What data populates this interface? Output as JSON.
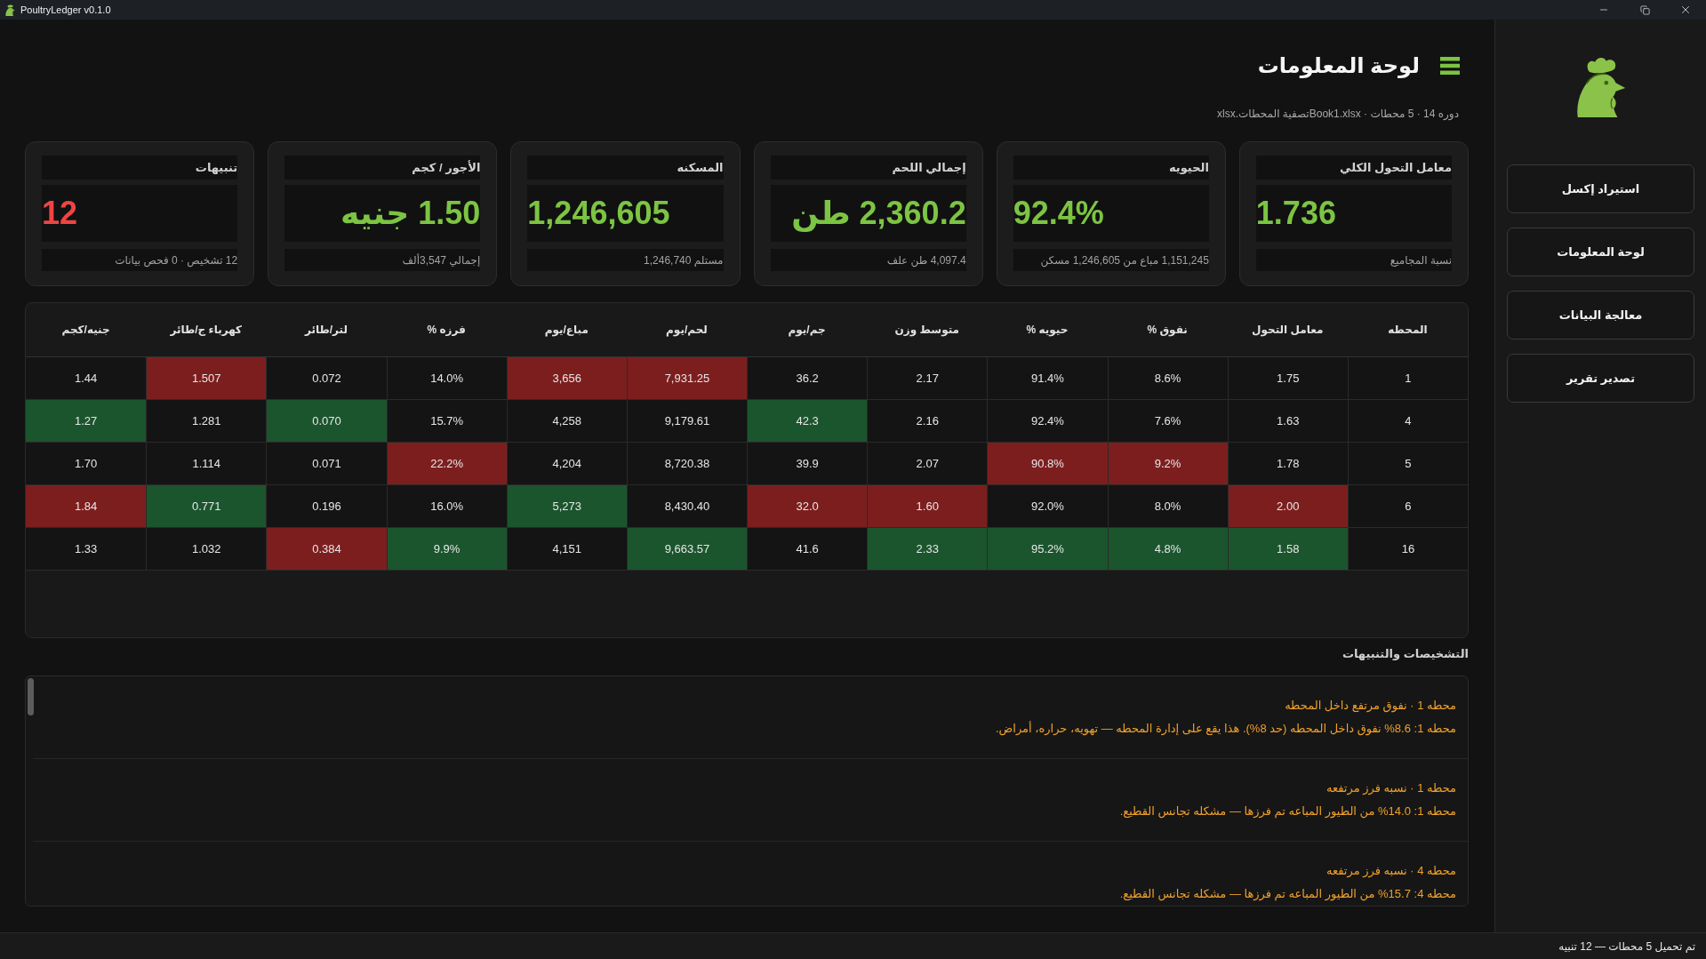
{
  "window": {
    "title": "PoultryLedger v0.1.0"
  },
  "header": {
    "title": "لوحة المعلومات",
    "subtitle": "دوره 14 · 5 محطات · Book1.xlsxتصفية المحطات.xlsx"
  },
  "kpi_cards": [
    {
      "label": "معامل التحول الكلي",
      "value": "1.736",
      "color": "#7cc443",
      "note": "نسبة المجاميع"
    },
    {
      "label": "الحيويه",
      "value": "92.4%",
      "color": "#7cc443",
      "note": "1,151,245 مباع من 1,246,605 مسكن"
    },
    {
      "label": "إجمالي اللحم",
      "value": "2,360.2 طن",
      "color": "#7cc443",
      "note": "4,097.4 طن علف"
    },
    {
      "label": "المسكنه",
      "value": "1,246,605",
      "color": "#7cc443",
      "note": "مستلم 1,246,740"
    },
    {
      "label": "الأجور / كجم",
      "value": "1.50 جنيه",
      "color": "#7cc443",
      "note": "إجمالي 3,547ألف"
    },
    {
      "label": "تنبيهات",
      "value": "12",
      "color": "#ef4444",
      "note": "12 تشخيص · 0 فحص بيانات"
    }
  ],
  "table": {
    "columns": [
      "المحطه",
      "معامل التحول",
      "نفوق %",
      "حيويه %",
      "متوسط وزن",
      "جم/يوم",
      "لحم/يوم",
      "مباع/يوم",
      "فرزه %",
      "لتر/طائر",
      "كهرباء ج/طائر",
      "جنيه/كجم"
    ],
    "rows": [
      {
        "cells": [
          {
            "value": "1"
          },
          {
            "value": "1.75"
          },
          {
            "value": "8.6%"
          },
          {
            "value": "91.4%"
          },
          {
            "value": "2.17"
          },
          {
            "value": "36.2"
          },
          {
            "value": "7,931.25",
            "color": "#7d1e1e"
          },
          {
            "value": "3,656",
            "color": "#7d1e1e"
          },
          {
            "value": "14.0%"
          },
          {
            "value": "0.072"
          },
          {
            "value": "1.507",
            "color": "#7d1e1e"
          },
          {
            "value": "1.44"
          }
        ]
      },
      {
        "cells": [
          {
            "value": "4"
          },
          {
            "value": "1.63"
          },
          {
            "value": "7.6%"
          },
          {
            "value": "92.4%"
          },
          {
            "value": "2.16"
          },
          {
            "value": "42.3",
            "color": "#1b552d"
          },
          {
            "value": "9,179.61"
          },
          {
            "value": "4,258"
          },
          {
            "value": "15.7%"
          },
          {
            "value": "0.070",
            "color": "#1b552d"
          },
          {
            "value": "1.281"
          },
          {
            "value": "1.27",
            "color": "#1b552d"
          }
        ]
      },
      {
        "cells": [
          {
            "value": "5"
          },
          {
            "value": "1.78"
          },
          {
            "value": "9.2%",
            "color": "#7d1e1e"
          },
          {
            "value": "90.8%",
            "color": "#7d1e1e"
          },
          {
            "value": "2.07"
          },
          {
            "value": "39.9"
          },
          {
            "value": "8,720.38"
          },
          {
            "value": "4,204"
          },
          {
            "value": "22.2%",
            "color": "#7d1e1e"
          },
          {
            "value": "0.071"
          },
          {
            "value": "1.114"
          },
          {
            "value": "1.70"
          }
        ]
      },
      {
        "cells": [
          {
            "value": "6"
          },
          {
            "value": "2.00",
            "color": "#7d1e1e"
          },
          {
            "value": "8.0%"
          },
          {
            "value": "92.0%"
          },
          {
            "value": "1.60",
            "color": "#7d1e1e"
          },
          {
            "value": "32.0",
            "color": "#7d1e1e"
          },
          {
            "value": "8,430.40"
          },
          {
            "value": "5,273",
            "color": "#1b552d"
          },
          {
            "value": "16.0%"
          },
          {
            "value": "0.196"
          },
          {
            "value": "0.771",
            "color": "#1b552d"
          },
          {
            "value": "1.84",
            "color": "#7d1e1e"
          }
        ]
      },
      {
        "cells": [
          {
            "value": "16"
          },
          {
            "value": "1.58",
            "color": "#1b552d"
          },
          {
            "value": "4.8%",
            "color": "#1b552d"
          },
          {
            "value": "95.2%",
            "color": "#1b552d"
          },
          {
            "value": "2.33",
            "color": "#1b552d"
          },
          {
            "value": "41.6"
          },
          {
            "value": "9,663.57",
            "color": "#1b552d"
          },
          {
            "value": "4,151"
          },
          {
            "value": "9.9%",
            "color": "#1b552d"
          },
          {
            "value": "0.384",
            "color": "#7d1e1e"
          },
          {
            "value": "1.032"
          },
          {
            "value": "1.33"
          }
        ]
      }
    ]
  },
  "alerts": {
    "title": "التشخيصات والتنبيهات",
    "items": [
      {
        "title": "محطه 1 · نفوق مرتفع داخل المحطه",
        "message": "محطه 1: 8.6% نفوق داخل المحطه (حد 8%). هذا يقع على إدارة المحطه — تهويه، حراره، أمراض."
      },
      {
        "title": "محطه 1 · نسبه فرز مرتفعه",
        "message": "محطه 1: 14.0% من الطيور المباعه تم فرزها — مشكله تجانس القطيع."
      },
      {
        "title": "محطه 4 · نسبه فرز مرتفعه",
        "message": "محطه 4: 15.7% من الطيور المباعه تم فرزها — مشكله تجانس القطيع."
      }
    ]
  },
  "sidebar": {
    "buttons": [
      "استيراد إكسل",
      "لوحة المعلومات",
      "معالجة البيانات",
      "تصدير تقرير"
    ]
  },
  "status_bar": {
    "text": "تم تحميل 5 محطات — 12 تنبيه"
  }
}
